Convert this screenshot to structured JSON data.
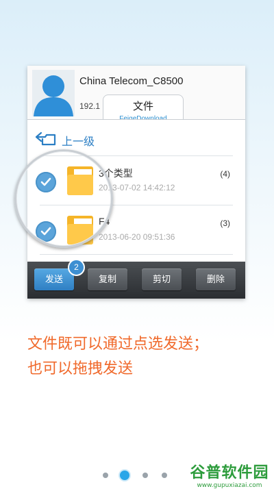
{
  "contact": {
    "name": "China Telecom_C8500",
    "ip": "192.1"
  },
  "tab": {
    "title": "文件",
    "subtitle": "FeigeDownload"
  },
  "up_level": "上一级",
  "files": [
    {
      "name": "3个类型",
      "date": "2013-07-02 14:42:12",
      "count": "(4)",
      "checked": true
    },
    {
      "name": "F4",
      "date": "2013-06-20 09:51:36",
      "count": "(3)",
      "checked": true
    }
  ],
  "toolbar": {
    "send": "发送",
    "copy": "复制",
    "cut": "剪切",
    "delete": "删除",
    "selected_count": "2"
  },
  "caption": {
    "line1": "文件既可以通过点选发送；",
    "line2": "也可以拖拽发送"
  },
  "pager": {
    "pages": 4,
    "active": 2
  },
  "watermark": {
    "main": "谷普软件园",
    "url": "www.gupuxiazai.com"
  },
  "colors": {
    "accent": "#2a8ed0",
    "caption": "#f0692b",
    "watermark": "#2d9c3c"
  }
}
